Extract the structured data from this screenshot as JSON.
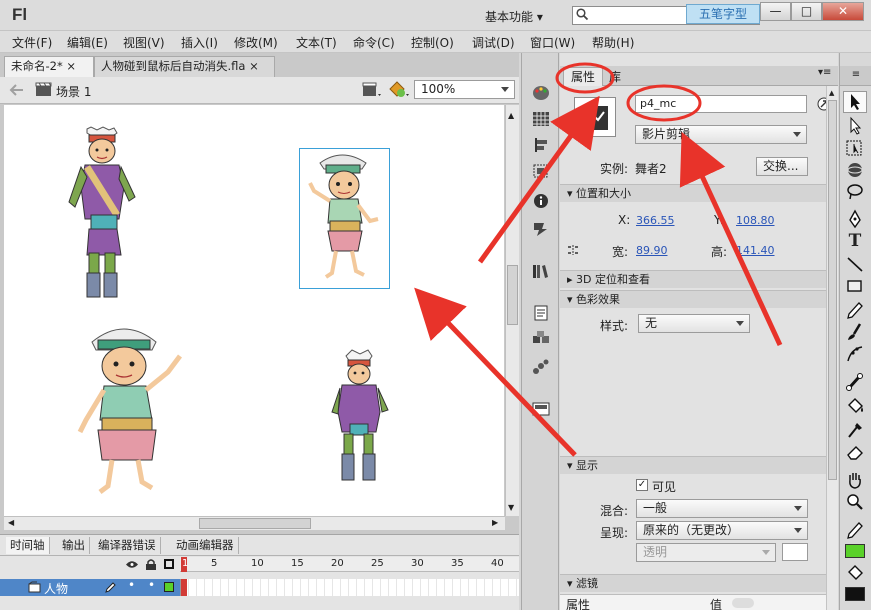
{
  "app": {
    "logo": "Fl",
    "workspace_label": "基本功能",
    "watermark": "五笔字型"
  },
  "window_buttons": {
    "minimize": "—",
    "maximize": "□",
    "close": "✕"
  },
  "menu": [
    "文件(F)",
    "编辑(E)",
    "视图(V)",
    "插入(I)",
    "修改(M)",
    "文本(T)",
    "命令(C)",
    "控制(O)",
    "调试(D)",
    "窗口(W)",
    "帮助(H)"
  ],
  "doc_tabs": [
    {
      "label": "未命名-2*",
      "close": "×",
      "active": true
    },
    {
      "label": "人物碰到鼠标后自动消失.fla",
      "close": "×",
      "active": false
    }
  ],
  "edit_bar": {
    "scene_label": "场景 1",
    "zoom": "100%"
  },
  "timeline": {
    "tabs": [
      "时间轴",
      "输出",
      "编译器错误",
      "动画编辑器"
    ],
    "ruler": [
      "1",
      "5",
      "10",
      "15",
      "20",
      "25",
      "30",
      "35",
      "40"
    ],
    "layer_name": "人物"
  },
  "properties": {
    "tabs": [
      "属性",
      "库"
    ],
    "instance_name": "p4_mc",
    "symbol_type": "影片剪辑",
    "instance_label": "实例:",
    "instance_value": "舞者2",
    "swap_button": "交换...",
    "section_position": "位置和大小",
    "x_label": "X:",
    "x_value": "366.55",
    "y_label": "Y:",
    "y_value": "108.80",
    "w_label": "宽:",
    "w_value": "89.90",
    "h_label": "高:",
    "h_value": "141.40",
    "section_3d": "3D 定位和查看",
    "section_color": "色彩效果",
    "style_label": "样式:",
    "style_value": "无",
    "section_display": "显示",
    "visible_label": "可见",
    "blend_label": "混合:",
    "blend_value": "一般",
    "render_label": "呈现:",
    "render_value": "原来的（无更改）",
    "transparent_value": "透明",
    "section_filter": "滤镜",
    "filter_col1": "属性",
    "filter_col2": "值"
  },
  "colors": {
    "annotation_red": "#e8332a",
    "selection_blue": "#3aa0d8",
    "fill_green": "#5ad12a",
    "stroke_black": "#111111"
  }
}
